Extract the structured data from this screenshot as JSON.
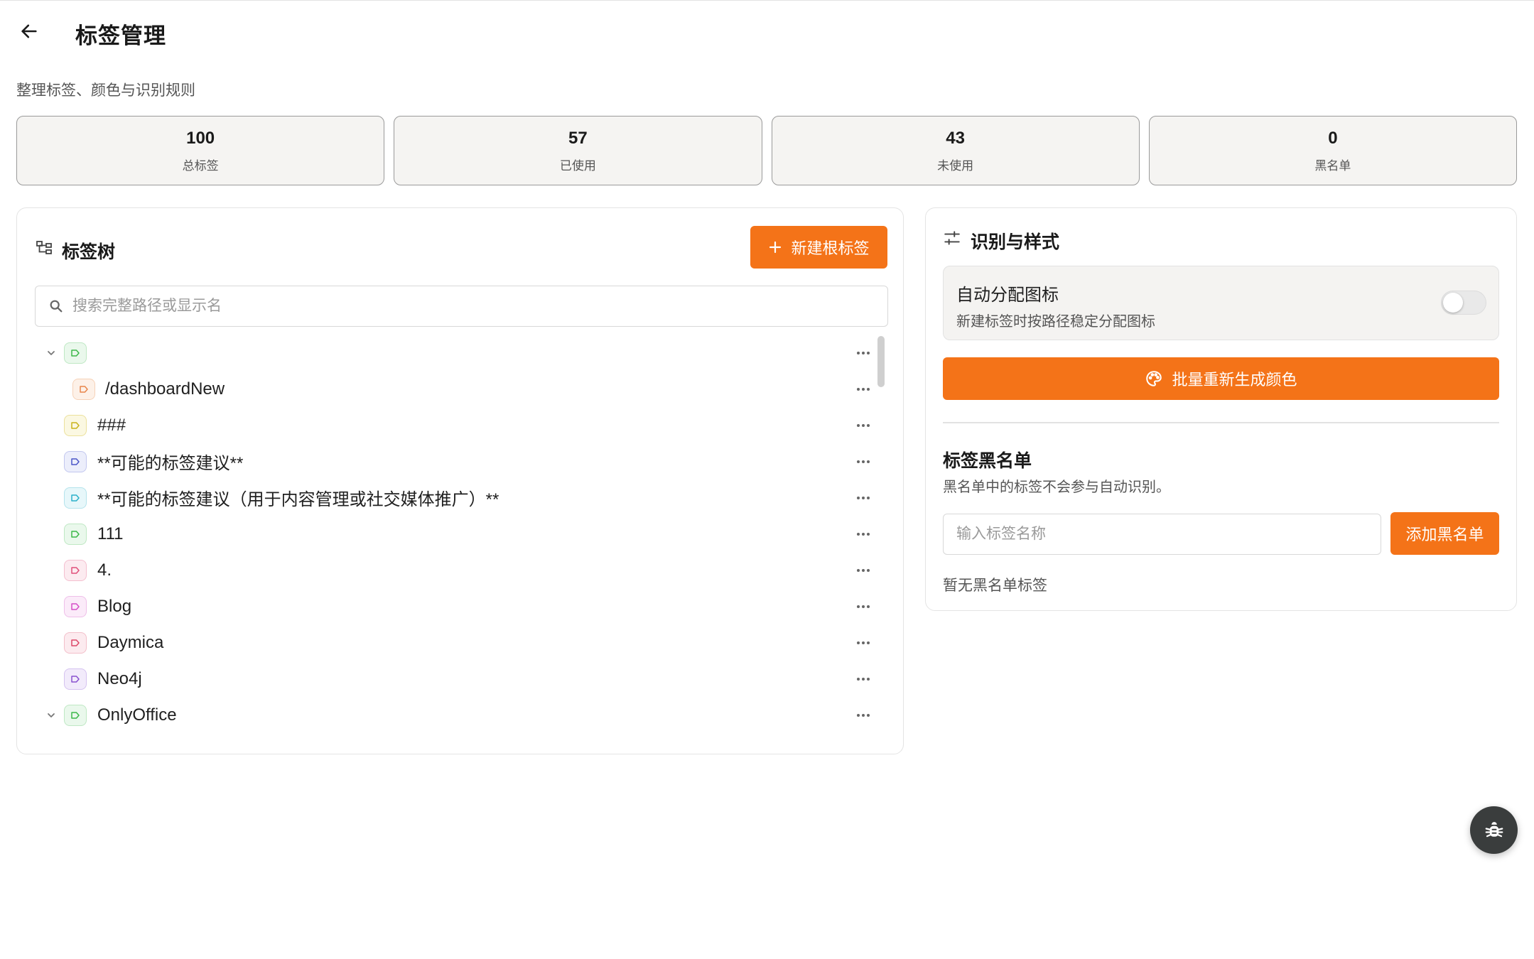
{
  "header": {
    "title": "标签管理",
    "subtitle": "整理标签、颜色与识别规则"
  },
  "stats": [
    {
      "value": "100",
      "label": "总标签"
    },
    {
      "value": "57",
      "label": "已使用"
    },
    {
      "value": "43",
      "label": "未使用"
    },
    {
      "value": "0",
      "label": "黑名单"
    }
  ],
  "tree_panel": {
    "title": "标签树",
    "new_root_label": "新建根标签",
    "search_placeholder": "搜索完整路径或显示名",
    "rows": [
      {
        "label": "",
        "color": "#3cb84a",
        "bg": "#eaf8ec",
        "border": "#bfe8c4",
        "expanded": true
      },
      {
        "label": "/dashboardNew",
        "color": "#e8864a",
        "bg": "#fdf1e8",
        "border": "#f6d2b8"
      },
      {
        "label": "###",
        "color": "#c9b21a",
        "bg": "#fbf8e2",
        "border": "#ece19c"
      },
      {
        "label": "**可能的标签建议**",
        "color": "#4b56c8",
        "bg": "#eceefb",
        "border": "#c2c7ef"
      },
      {
        "label": "**可能的标签建议（用于内容管理或社交媒体推广）**",
        "color": "#2bb1c9",
        "bg": "#e7f7fa",
        "border": "#b4e3ec"
      },
      {
        "label": "111",
        "color": "#3cb84a",
        "bg": "#eaf8ec",
        "border": "#bfe8c4"
      },
      {
        "label": "4.",
        "color": "#e0507a",
        "bg": "#fcebf0",
        "border": "#f4bfcf"
      },
      {
        "label": "Blog",
        "color": "#d64ec8",
        "bg": "#fbebf9",
        "border": "#efbfe9"
      },
      {
        "label": "Daymica",
        "color": "#dc4868",
        "bg": "#fcebef",
        "border": "#f3bfca"
      },
      {
        "label": "Neo4j",
        "color": "#8a52d0",
        "bg": "#f2ebfb",
        "border": "#d5c2f0"
      },
      {
        "label": "OnlyOffice",
        "color": "#3cb84a",
        "bg": "#eaf8ec",
        "border": "#bfe8c4",
        "expanded": true
      }
    ]
  },
  "style_panel": {
    "title": "识别与样式",
    "auto_icon_title": "自动分配图标",
    "auto_icon_desc": "新建标签时按路径稳定分配图标",
    "auto_icon_enabled": false,
    "regen_colors_label": "批量重新生成颜色",
    "blacklist_title": "标签黑名单",
    "blacklist_desc": "黑名单中的标签不会参与自动识别。",
    "blacklist_placeholder": "输入标签名称",
    "blacklist_add_label": "添加黑名单",
    "blacklist_empty": "暂无黑名单标签"
  },
  "icons": {
    "back": "arrow-left-icon",
    "tree": "tree-icon",
    "plus": "plus-icon",
    "search": "search-icon",
    "tune": "sliders-icon",
    "palette": "palette-icon",
    "bug": "bug-icon",
    "more": "more-horizontal-icon",
    "chevron": "chevron-down-icon",
    "tag": "tag-icon"
  },
  "colors": {
    "accent": "#f47318",
    "fab": "#3a3d3d"
  }
}
